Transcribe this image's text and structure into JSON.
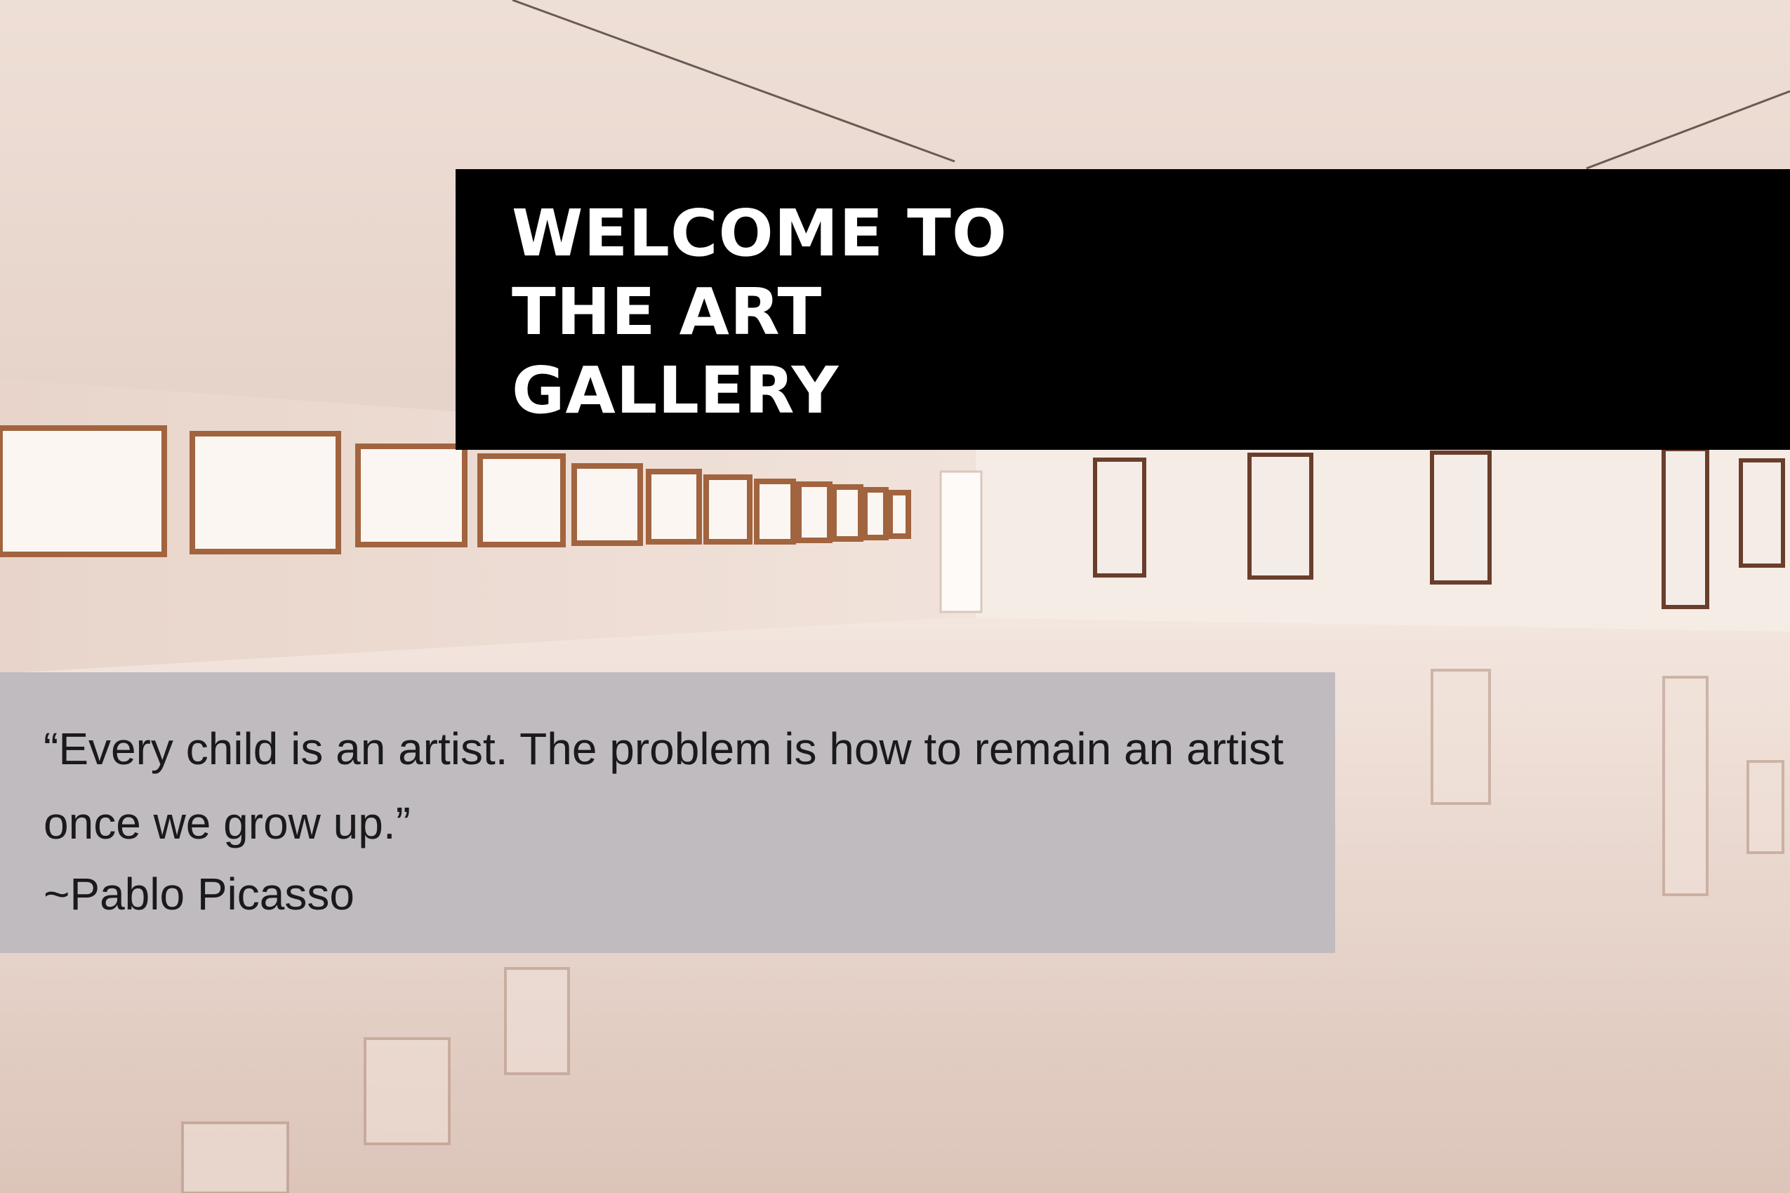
{
  "banner": {
    "title": "WELCOME TO THE ART GALLERY"
  },
  "quote": {
    "text": "“Every child is an artist. The problem is how to remain an artist once we grow up.”",
    "author": "~Pablo Picasso"
  },
  "colors": {
    "banner_bg": "#000000",
    "banner_text": "#ffffff",
    "quote_bg": "#bfbbbf",
    "quote_text": "#1a1a1a",
    "photo_tint": "#e9d6cc"
  }
}
